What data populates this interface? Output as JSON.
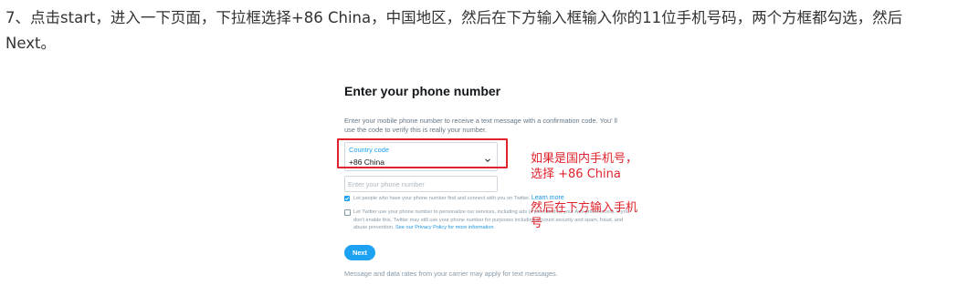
{
  "article": {
    "instruction": "7、点击start，进入一下页面，下拉框选择+86 China，中国地区，然后在下方输入框输入你的11位手机号码，两个方框都勾选，然后Next。"
  },
  "screenshot": {
    "title": "Enter your phone number",
    "description": "Enter your mobile phone number to receive a text message with a confirmation code. You' ll use the code to verify this is really your number.",
    "country": {
      "label": "Country code",
      "selected": "+86 China"
    },
    "phone": {
      "placeholder": "Enter your phone number"
    },
    "option1": {
      "text": "Let people who have your phone number find and connect with you on Twitter.",
      "link": "Learn more",
      "checked": true
    },
    "option2": {
      "text": "Let Twitter use your phone number to personalize our services, including ads (if permitted by your Ads preferences). If you don't enable this, Twitter may still use your phone number for purposes including account security and spam, fraud, and abuse prevention.",
      "link": "See our Privacy Policy for more information",
      "checked": false
    },
    "next_label": "Next",
    "footnote": "Message and data rates from your carrier may apply for text messages."
  },
  "annotations": {
    "country_note_line1": "如果是国内手机号，",
    "country_note_line2": "选择  +86 China",
    "phone_note_line1": "然后在下方输入手机",
    "phone_note_line2": "号",
    "highlight_color": "#e0232c"
  },
  "colors": {
    "accent": "#1da1f2",
    "annotation": "#e0232c"
  }
}
